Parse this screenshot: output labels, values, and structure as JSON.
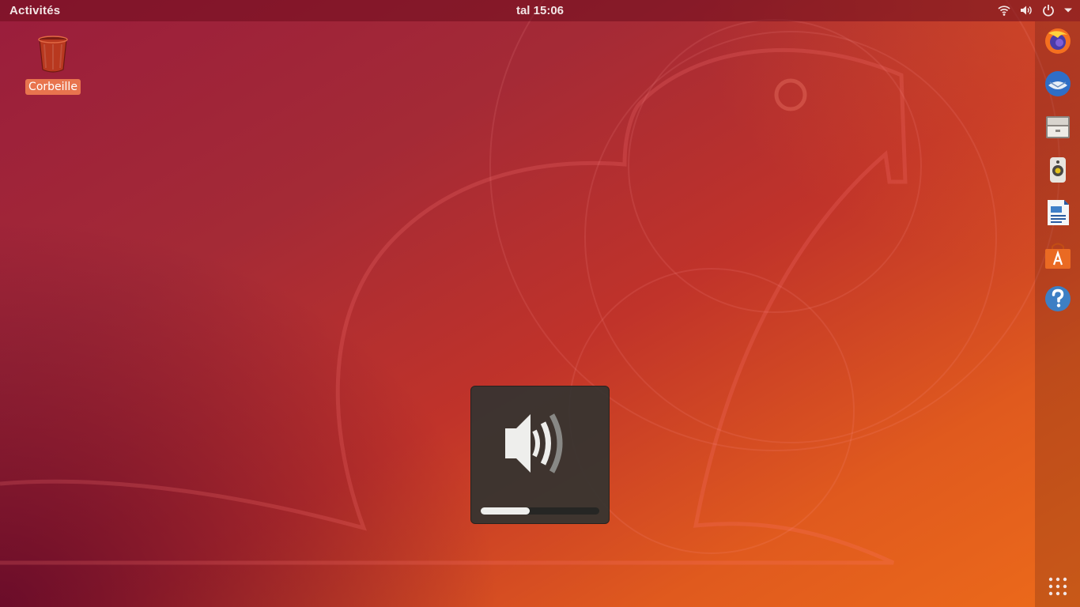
{
  "topbar": {
    "activities_label": "Activités",
    "clock": "tal 15:06",
    "tray_icons": [
      "wifi-icon",
      "volume-icon",
      "power-icon",
      "chevron-down-icon"
    ]
  },
  "desktop": {
    "trash": {
      "icon": "trash-icon",
      "label": "Corbeille"
    }
  },
  "dock": {
    "items": [
      {
        "name": "firefox",
        "icon": "firefox-icon"
      },
      {
        "name": "thunderbird",
        "icon": "thunderbird-icon"
      },
      {
        "name": "files",
        "icon": "files-icon"
      },
      {
        "name": "rhythmbox",
        "icon": "rhythmbox-icon"
      },
      {
        "name": "libreoffice-writer",
        "icon": "writer-icon"
      },
      {
        "name": "ubuntu-software",
        "icon": "software-icon"
      },
      {
        "name": "help",
        "icon": "help-icon"
      }
    ],
    "show_apps_icon": "grid-icon"
  },
  "osd": {
    "icon": "speaker-high-icon",
    "volume_fraction": 0.41
  },
  "colors": {
    "wallpaper_start": "#9a1d3c",
    "wallpaper_end": "#ec6a1a",
    "label_highlight": "#e8744e",
    "osd_bg": "#343430"
  }
}
